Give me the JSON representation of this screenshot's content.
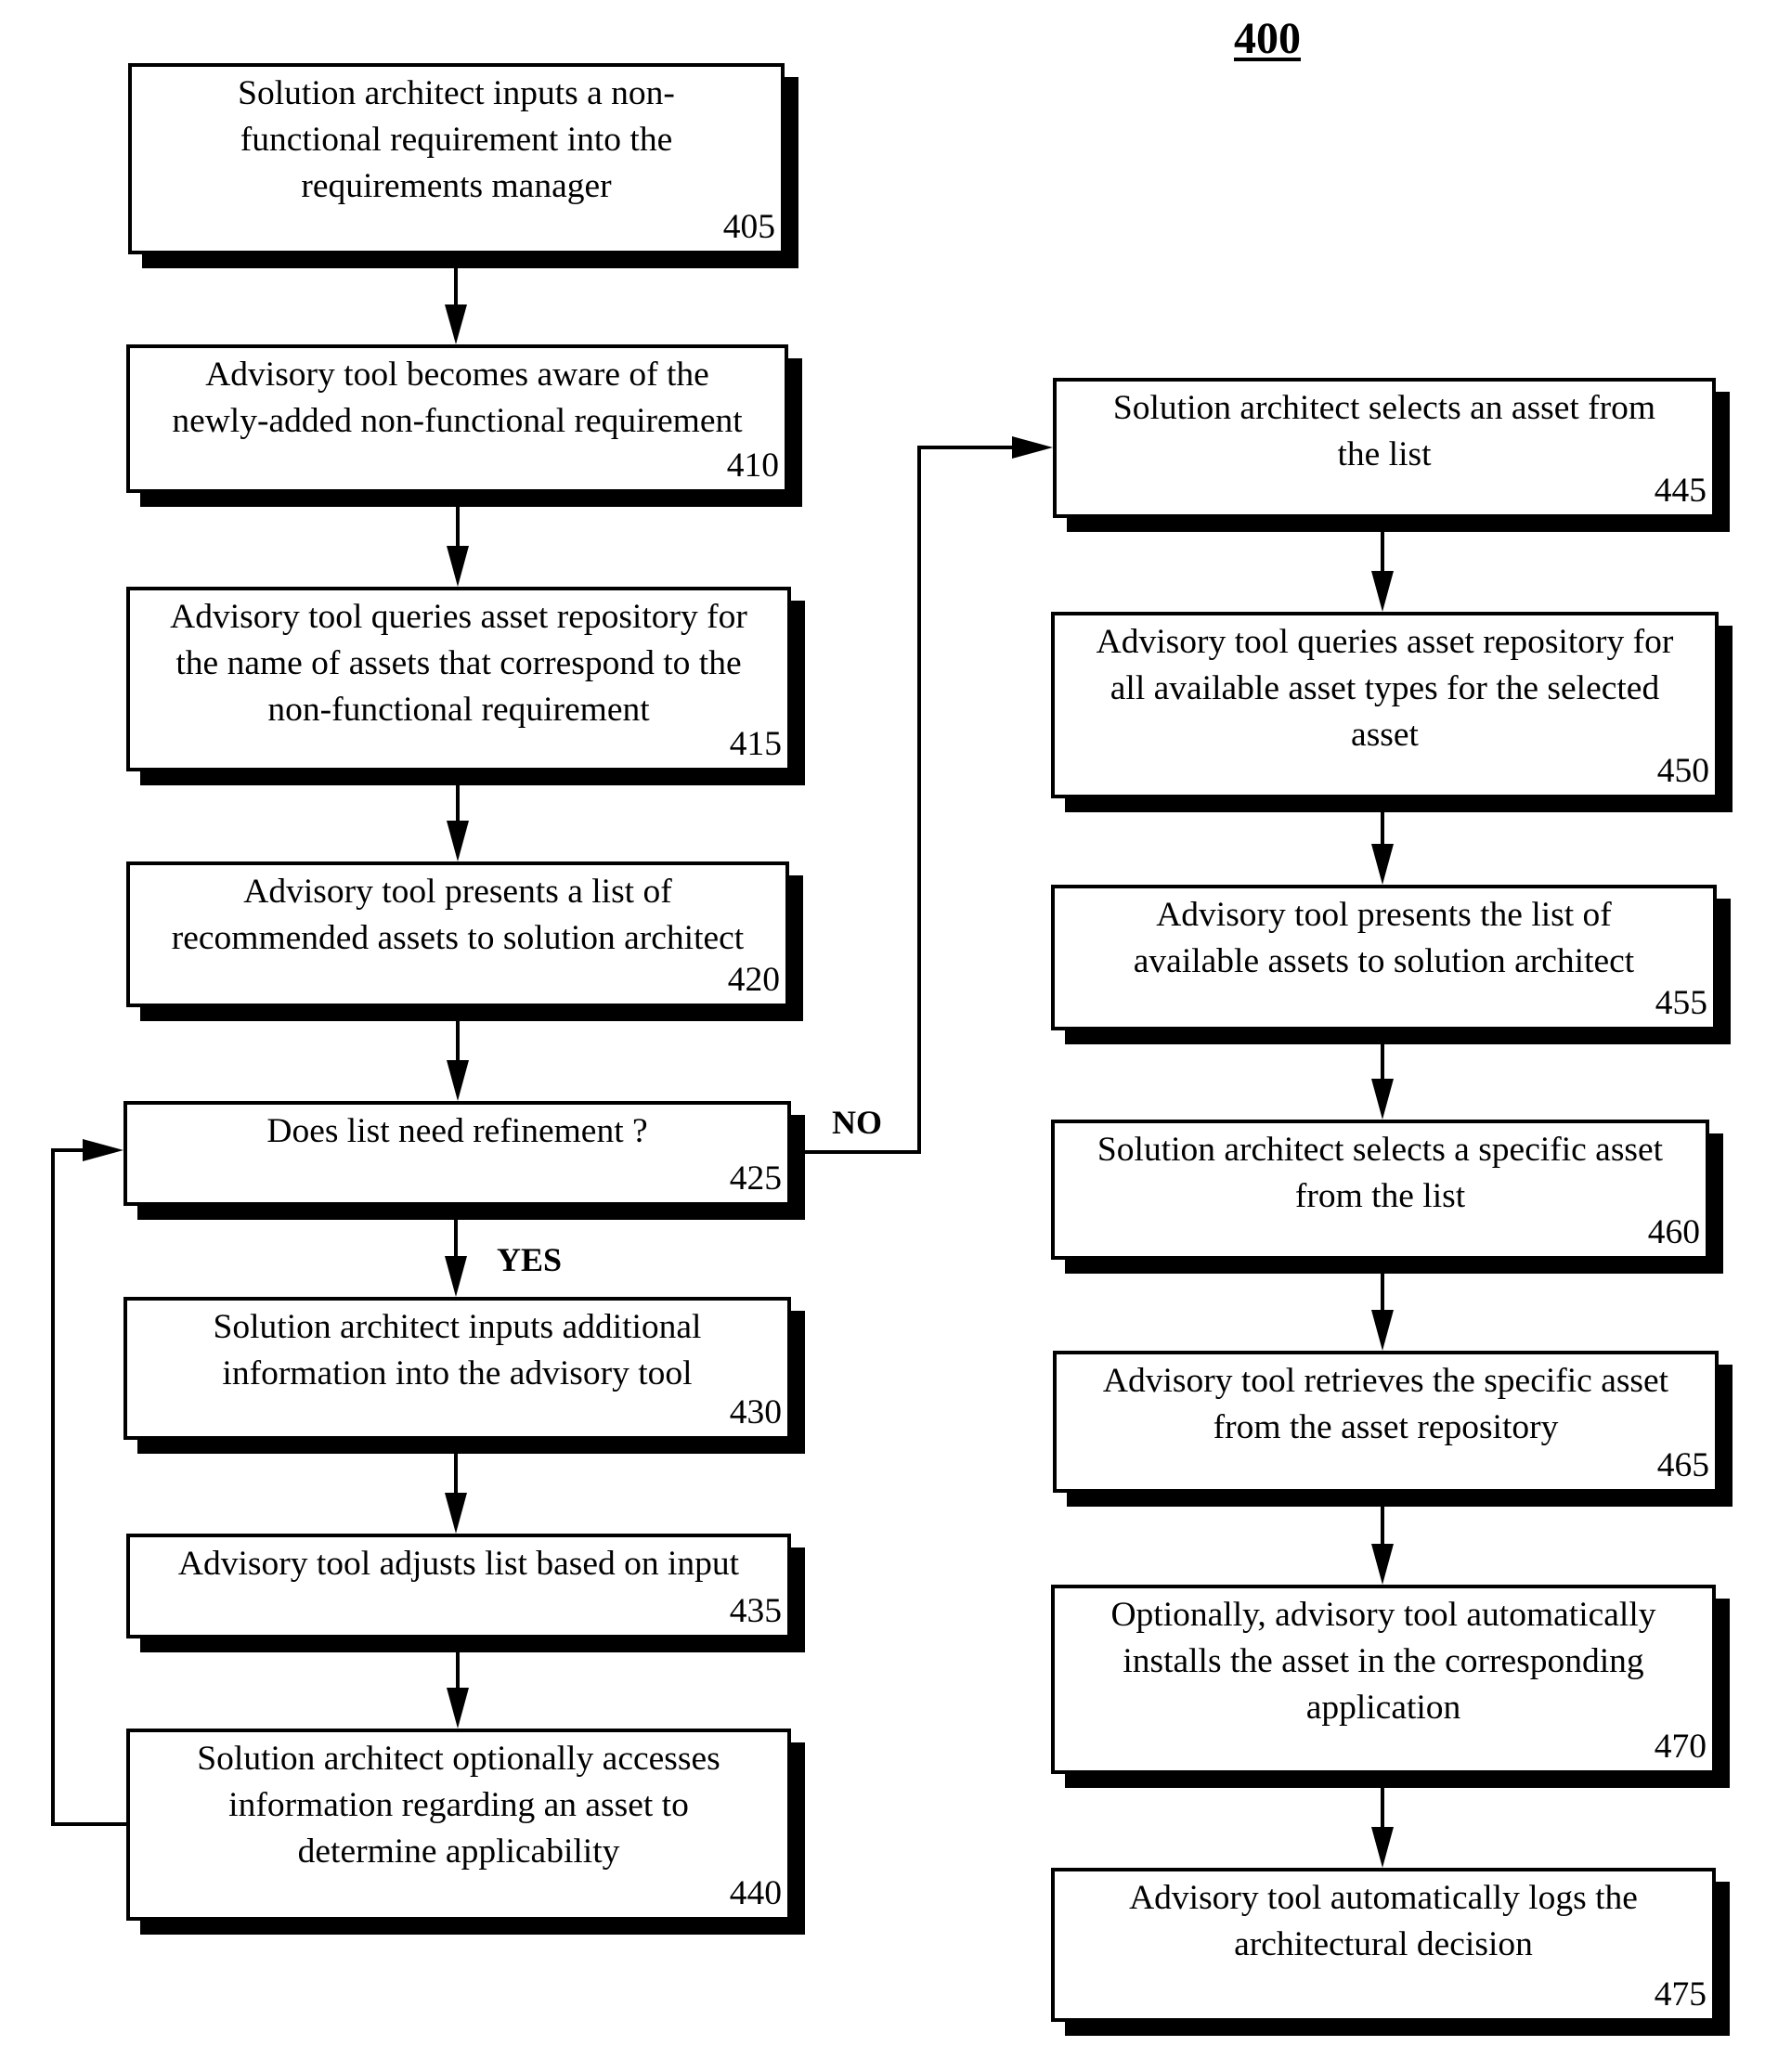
{
  "figure": {
    "number": "400"
  },
  "steps": {
    "s405": {
      "text": "Solution architect inputs a non-\nfunctional requirement into the\nrequirements manager",
      "ref": "405"
    },
    "s410": {
      "text": "Advisory tool becomes aware of the\nnewly-added non-functional requirement",
      "ref": "410"
    },
    "s415": {
      "text": "Advisory tool queries asset repository for\nthe name of assets that correspond to the\nnon-functional requirement",
      "ref": "415"
    },
    "s420": {
      "text": "Advisory tool presents a list of\nrecommended assets to solution architect",
      "ref": "420"
    },
    "s425": {
      "text": "Does list need refinement ?",
      "ref": "425"
    },
    "s430": {
      "text": "Solution architect inputs additional\ninformation into the advisory tool",
      "ref": "430"
    },
    "s435": {
      "text": "Advisory tool adjusts list based on input",
      "ref": "435"
    },
    "s440": {
      "text": "Solution architect optionally accesses\ninformation regarding an asset to\ndetermine applicability",
      "ref": "440"
    },
    "s445": {
      "text": "Solution architect selects an asset from\nthe list",
      "ref": "445"
    },
    "s450": {
      "text": "Advisory tool queries asset repository for\nall available asset types for the selected\nasset",
      "ref": "450"
    },
    "s455": {
      "text": "Advisory tool presents the list of\navailable assets to solution architect",
      "ref": "455"
    },
    "s460": {
      "text": "Solution architect selects a specific asset\nfrom the list",
      "ref": "460"
    },
    "s465": {
      "text": "Advisory tool retrieves the specific asset\nfrom the asset repository",
      "ref": "465"
    },
    "s470": {
      "text": "Optionally, advisory tool automatically\ninstalls the asset in the corresponding\napplication",
      "ref": "470"
    },
    "s475": {
      "text": "Advisory tool automatically logs the\narchitectural decision",
      "ref": "475"
    }
  },
  "branches": {
    "no": "NO",
    "yes": "YES"
  }
}
